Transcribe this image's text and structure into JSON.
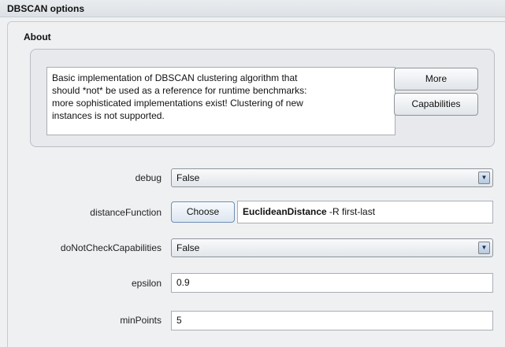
{
  "window": {
    "title": "DBSCAN options"
  },
  "about": {
    "title": "About",
    "description": "Basic implementation of DBSCAN clustering algorithm that\nshould *not* be used as a reference for runtime benchmarks:\nmore sophisticated implementations exist! Clustering of new\ninstances is not supported.",
    "more_label": "More",
    "capabilities_label": "Capabilities"
  },
  "options": {
    "debug": {
      "label": "debug",
      "value": "False"
    },
    "distanceFunction": {
      "label": "distanceFunction",
      "choose_label": "Choose",
      "class_name": "EuclideanDistance",
      "args": " -R first-last"
    },
    "doNotCheckCapabilities": {
      "label": "doNotCheckCapabilities",
      "value": "False"
    },
    "epsilon": {
      "label": "epsilon",
      "value": "0.9"
    },
    "minPoints": {
      "label": "minPoints",
      "value": "5"
    }
  },
  "icons": {
    "dropdown": "dropdown-arrow-icon"
  }
}
